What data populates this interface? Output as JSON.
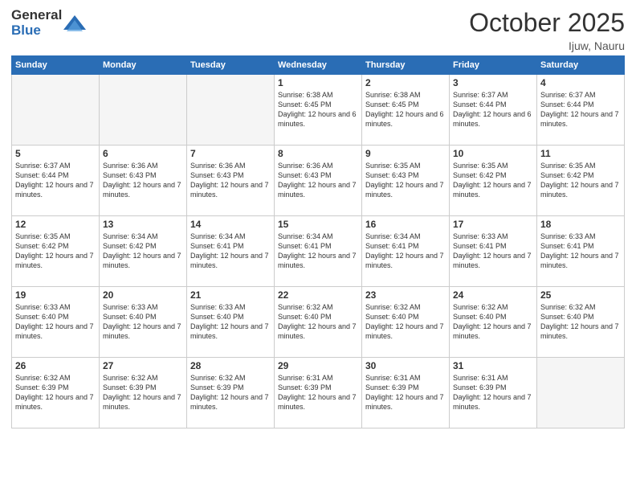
{
  "header": {
    "logo_general": "General",
    "logo_blue": "Blue",
    "month_title": "October 2025",
    "location": "Ijuw, Nauru"
  },
  "calendar": {
    "days_of_week": [
      "Sunday",
      "Monday",
      "Tuesday",
      "Wednesday",
      "Thursday",
      "Friday",
      "Saturday"
    ],
    "weeks": [
      [
        {
          "day": "",
          "sunrise": "",
          "sunset": "",
          "daylight": ""
        },
        {
          "day": "",
          "sunrise": "",
          "sunset": "",
          "daylight": ""
        },
        {
          "day": "",
          "sunrise": "",
          "sunset": "",
          "daylight": ""
        },
        {
          "day": "1",
          "sunrise": "Sunrise: 6:38 AM",
          "sunset": "Sunset: 6:45 PM",
          "daylight": "Daylight: 12 hours and 6 minutes."
        },
        {
          "day": "2",
          "sunrise": "Sunrise: 6:38 AM",
          "sunset": "Sunset: 6:45 PM",
          "daylight": "Daylight: 12 hours and 6 minutes."
        },
        {
          "day": "3",
          "sunrise": "Sunrise: 6:37 AM",
          "sunset": "Sunset: 6:44 PM",
          "daylight": "Daylight: 12 hours and 6 minutes."
        },
        {
          "day": "4",
          "sunrise": "Sunrise: 6:37 AM",
          "sunset": "Sunset: 6:44 PM",
          "daylight": "Daylight: 12 hours and 7 minutes."
        }
      ],
      [
        {
          "day": "5",
          "sunrise": "Sunrise: 6:37 AM",
          "sunset": "Sunset: 6:44 PM",
          "daylight": "Daylight: 12 hours and 7 minutes."
        },
        {
          "day": "6",
          "sunrise": "Sunrise: 6:36 AM",
          "sunset": "Sunset: 6:43 PM",
          "daylight": "Daylight: 12 hours and 7 minutes."
        },
        {
          "day": "7",
          "sunrise": "Sunrise: 6:36 AM",
          "sunset": "Sunset: 6:43 PM",
          "daylight": "Daylight: 12 hours and 7 minutes."
        },
        {
          "day": "8",
          "sunrise": "Sunrise: 6:36 AM",
          "sunset": "Sunset: 6:43 PM",
          "daylight": "Daylight: 12 hours and 7 minutes."
        },
        {
          "day": "9",
          "sunrise": "Sunrise: 6:35 AM",
          "sunset": "Sunset: 6:43 PM",
          "daylight": "Daylight: 12 hours and 7 minutes."
        },
        {
          "day": "10",
          "sunrise": "Sunrise: 6:35 AM",
          "sunset": "Sunset: 6:42 PM",
          "daylight": "Daylight: 12 hours and 7 minutes."
        },
        {
          "day": "11",
          "sunrise": "Sunrise: 6:35 AM",
          "sunset": "Sunset: 6:42 PM",
          "daylight": "Daylight: 12 hours and 7 minutes."
        }
      ],
      [
        {
          "day": "12",
          "sunrise": "Sunrise: 6:35 AM",
          "sunset": "Sunset: 6:42 PM",
          "daylight": "Daylight: 12 hours and 7 minutes."
        },
        {
          "day": "13",
          "sunrise": "Sunrise: 6:34 AM",
          "sunset": "Sunset: 6:42 PM",
          "daylight": "Daylight: 12 hours and 7 minutes."
        },
        {
          "day": "14",
          "sunrise": "Sunrise: 6:34 AM",
          "sunset": "Sunset: 6:41 PM",
          "daylight": "Daylight: 12 hours and 7 minutes."
        },
        {
          "day": "15",
          "sunrise": "Sunrise: 6:34 AM",
          "sunset": "Sunset: 6:41 PM",
          "daylight": "Daylight: 12 hours and 7 minutes."
        },
        {
          "day": "16",
          "sunrise": "Sunrise: 6:34 AM",
          "sunset": "Sunset: 6:41 PM",
          "daylight": "Daylight: 12 hours and 7 minutes."
        },
        {
          "day": "17",
          "sunrise": "Sunrise: 6:33 AM",
          "sunset": "Sunset: 6:41 PM",
          "daylight": "Daylight: 12 hours and 7 minutes."
        },
        {
          "day": "18",
          "sunrise": "Sunrise: 6:33 AM",
          "sunset": "Sunset: 6:41 PM",
          "daylight": "Daylight: 12 hours and 7 minutes."
        }
      ],
      [
        {
          "day": "19",
          "sunrise": "Sunrise: 6:33 AM",
          "sunset": "Sunset: 6:40 PM",
          "daylight": "Daylight: 12 hours and 7 minutes."
        },
        {
          "day": "20",
          "sunrise": "Sunrise: 6:33 AM",
          "sunset": "Sunset: 6:40 PM",
          "daylight": "Daylight: 12 hours and 7 minutes."
        },
        {
          "day": "21",
          "sunrise": "Sunrise: 6:33 AM",
          "sunset": "Sunset: 6:40 PM",
          "daylight": "Daylight: 12 hours and 7 minutes."
        },
        {
          "day": "22",
          "sunrise": "Sunrise: 6:32 AM",
          "sunset": "Sunset: 6:40 PM",
          "daylight": "Daylight: 12 hours and 7 minutes."
        },
        {
          "day": "23",
          "sunrise": "Sunrise: 6:32 AM",
          "sunset": "Sunset: 6:40 PM",
          "daylight": "Daylight: 12 hours and 7 minutes."
        },
        {
          "day": "24",
          "sunrise": "Sunrise: 6:32 AM",
          "sunset": "Sunset: 6:40 PM",
          "daylight": "Daylight: 12 hours and 7 minutes."
        },
        {
          "day": "25",
          "sunrise": "Sunrise: 6:32 AM",
          "sunset": "Sunset: 6:40 PM",
          "daylight": "Daylight: 12 hours and 7 minutes."
        }
      ],
      [
        {
          "day": "26",
          "sunrise": "Sunrise: 6:32 AM",
          "sunset": "Sunset: 6:39 PM",
          "daylight": "Daylight: 12 hours and 7 minutes."
        },
        {
          "day": "27",
          "sunrise": "Sunrise: 6:32 AM",
          "sunset": "Sunset: 6:39 PM",
          "daylight": "Daylight: 12 hours and 7 minutes."
        },
        {
          "day": "28",
          "sunrise": "Sunrise: 6:32 AM",
          "sunset": "Sunset: 6:39 PM",
          "daylight": "Daylight: 12 hours and 7 minutes."
        },
        {
          "day": "29",
          "sunrise": "Sunrise: 6:31 AM",
          "sunset": "Sunset: 6:39 PM",
          "daylight": "Daylight: 12 hours and 7 minutes."
        },
        {
          "day": "30",
          "sunrise": "Sunrise: 6:31 AM",
          "sunset": "Sunset: 6:39 PM",
          "daylight": "Daylight: 12 hours and 7 minutes."
        },
        {
          "day": "31",
          "sunrise": "Sunrise: 6:31 AM",
          "sunset": "Sunset: 6:39 PM",
          "daylight": "Daylight: 12 hours and 7 minutes."
        },
        {
          "day": "",
          "sunrise": "",
          "sunset": "",
          "daylight": ""
        }
      ]
    ]
  }
}
